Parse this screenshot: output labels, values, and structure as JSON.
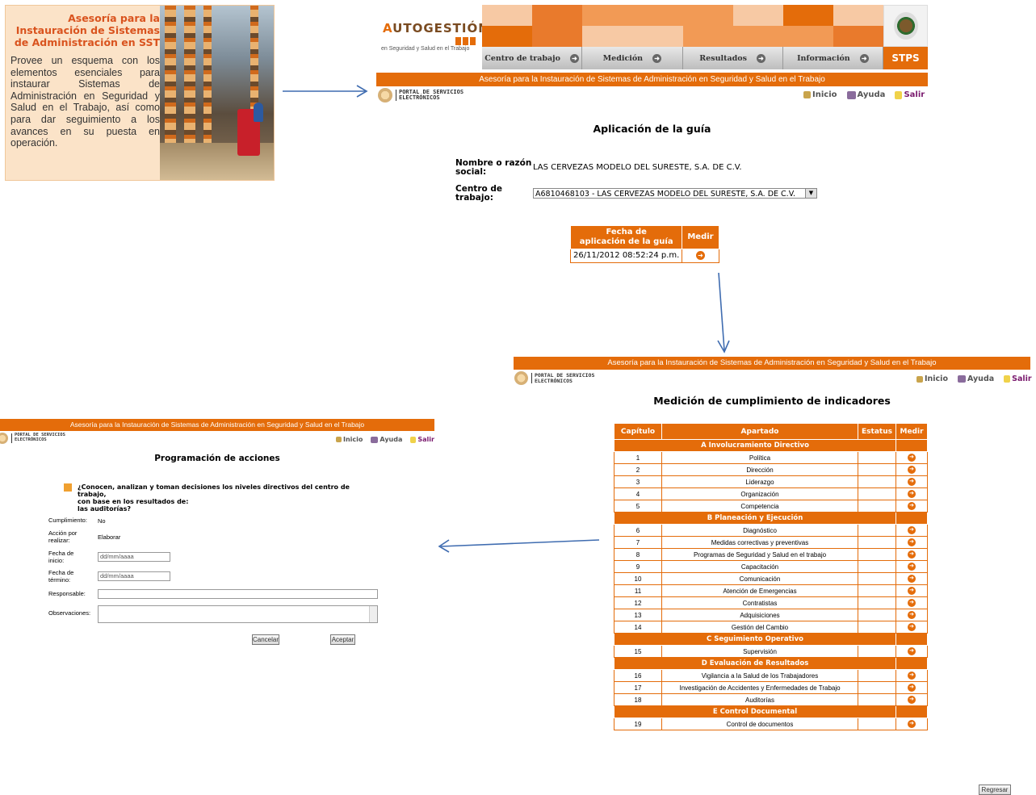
{
  "promo": {
    "title": "Asesoría para la Instauración de Sistemas de Administración en SST",
    "description": "Provee un esquema con los elementos esenciales para instaurar Sistemas de Administración en Seguridad y Salud en el Trabajo, así como para dar seguimiento a los avances en su puesta en operación."
  },
  "colors": {
    "accent": "#e46c0a",
    "accent_light": "#fbe3c8",
    "link_purple": "#7a1a6e"
  },
  "screen1": {
    "logo": {
      "title_first": "A",
      "title_rest": "UTOGESTIÓN",
      "subtitle": "en Seguridad y Salud en el Trabajo"
    },
    "nav": [
      "Centro de trabajo",
      "Medición",
      "Resultados",
      "Información"
    ],
    "stps": "STPS",
    "banner": "Asesoría para la Instauración de Sistemas de Administración en Seguridad y Salud en el Trabajo",
    "portal": {
      "line1": "PORTAL DE SERVICIOS",
      "line2": "ELECTRÓNICOS"
    },
    "links": {
      "inicio": "Inicio",
      "ayuda": "Ayuda",
      "salir": "Salir"
    },
    "heading": "Aplicación de la guía",
    "name_label_1": "Nombre o razón",
    "name_label_2": "social:",
    "name_value": "LAS CERVEZAS MODELO DEL SURESTE, S.A. DE C.V.",
    "center_label_1": "Centro de",
    "center_label_2": "trabajo:",
    "center_value": "A6810468103 - LAS CERVEZAS MODELO DEL SURESTE, S.A. DE C.V.",
    "table": {
      "col_fecha_1": "Fecha de",
      "col_fecha_2": "aplicación de la guía",
      "col_medir": "Medir",
      "date": "26/11/2012 08:52:24 p.m."
    }
  },
  "screen2": {
    "banner": "Asesoría para la Instauración de Sistemas de Administración en Seguridad y Salud en el Trabajo",
    "portal": {
      "line1": "PORTAL DE SERVICIOS",
      "line2": "ELECTRÓNICOS"
    },
    "links": {
      "inicio": "Inicio",
      "ayuda": "Ayuda",
      "salir": "Salir"
    },
    "heading": "Medición de cumplimiento de indicadores",
    "headers": {
      "capitulo": "Capítulo",
      "apartado": "Apartado",
      "estatus": "Estatus",
      "medir": "Medir"
    },
    "sections": [
      {
        "title": "A Involucramiento Directivo",
        "rows": [
          {
            "n": "1",
            "name": "Política"
          },
          {
            "n": "2",
            "name": "Dirección"
          },
          {
            "n": "3",
            "name": "Liderazgo"
          },
          {
            "n": "4",
            "name": "Organización"
          },
          {
            "n": "5",
            "name": "Competencia"
          }
        ]
      },
      {
        "title": "B Planeación y Ejecución",
        "rows": [
          {
            "n": "6",
            "name": "Diagnóstico"
          },
          {
            "n": "7",
            "name": "Medidas correctivas y preventivas"
          },
          {
            "n": "8",
            "name": "Programas de Seguridad y Salud en el trabajo"
          },
          {
            "n": "9",
            "name": "Capacitación"
          },
          {
            "n": "10",
            "name": "Comunicación"
          },
          {
            "n": "11",
            "name": "Atención de Emergencias"
          },
          {
            "n": "12",
            "name": "Contratistas"
          },
          {
            "n": "13",
            "name": "Adquisiciones"
          },
          {
            "n": "14",
            "name": "Gestión del Cambio"
          }
        ]
      },
      {
        "title": "C Seguimiento Operativo",
        "rows": [
          {
            "n": "15",
            "name": "Supervisión"
          }
        ]
      },
      {
        "title": "D Evaluación de Resultados",
        "rows": [
          {
            "n": "16",
            "name": "Vigilancia a la Salud de los Trabajadores"
          },
          {
            "n": "17",
            "name": "Investigación de Accidentes y Enfermedades de Trabajo"
          },
          {
            "n": "18",
            "name": "Auditorías"
          }
        ]
      },
      {
        "title": "E Control Documental",
        "rows": [
          {
            "n": "19",
            "name": "Control de documentos"
          }
        ]
      }
    ],
    "back_button": "Regresar"
  },
  "screen3": {
    "banner": "Asesoría para la Instauración de Sistemas de Administración en Seguridad y Salud en el Trabajo",
    "portal": {
      "line1": "PORTAL DE SERVICIOS",
      "line2": "ELECTRÓNICOS"
    },
    "links": {
      "inicio": "Inicio",
      "ayuda": "Ayuda",
      "salir": "Salir"
    },
    "heading": "Programación de acciones",
    "question_1": "¿Conocen, analizan y toman decisiones los niveles directivos del centro de trabajo,",
    "question_2": "con base en los resultados de:",
    "question_3": "las auditorías?",
    "cumplimiento_label": "Cumplimiento:",
    "cumplimiento_value": "No",
    "accion_label_1": "Acción por",
    "accion_label_2": "realizar:",
    "accion_value": "Elaborar",
    "inicio_label_1": "Fecha de",
    "inicio_label_2": "inicio:",
    "inicio_placeholder": "dd/mm/aaaa",
    "termino_label_1": "Fecha de",
    "termino_label_2": "término:",
    "termino_placeholder": "dd/mm/aaaa",
    "responsable_label": "Responsable:",
    "observaciones_label": "Observaciones:",
    "cancel": "Cancelar",
    "accept": "Aceptar"
  }
}
